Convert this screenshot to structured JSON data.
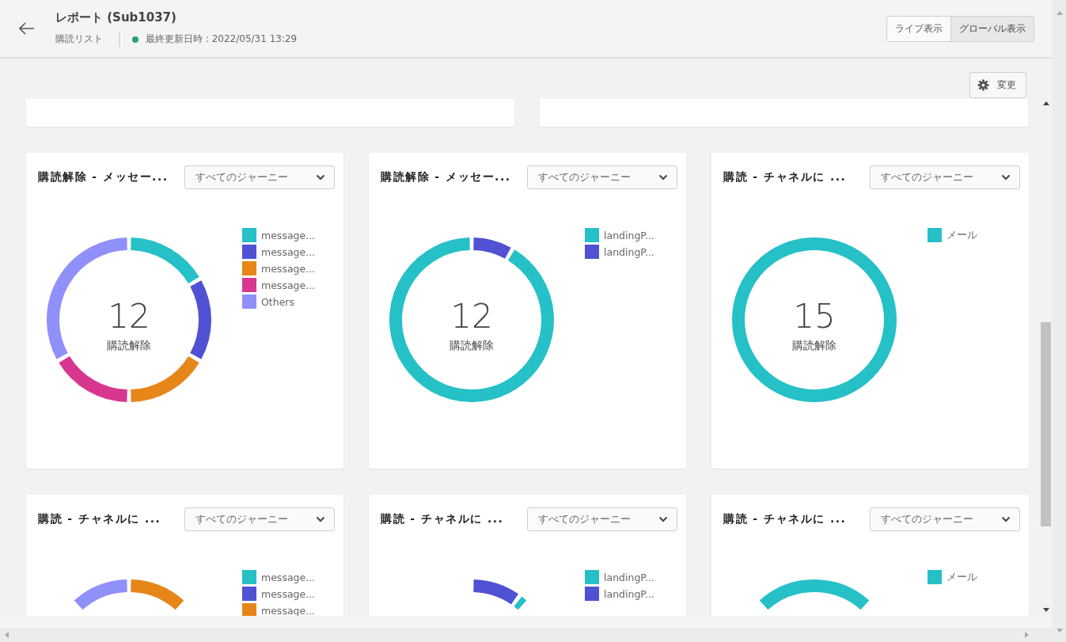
{
  "header": {
    "title": "レポート (Sub1037)",
    "subtitle": "購読リスト",
    "status": "最終更新日時 : 2022/05/31 13:29"
  },
  "view_toggle": [
    {
      "label": "ライブ表示",
      "selected": false
    },
    {
      "label": "グローバル表示",
      "selected": true
    }
  ],
  "change_button": "変更",
  "cards": [
    {
      "title": "購読解除 - メッセー...",
      "dropdown": "すべてのジャーニー",
      "total": "12",
      "total_label": "購読解除",
      "legend": [
        {
          "label": "message...",
          "color": "#26c0c7"
        },
        {
          "label": "message...",
          "color": "#5151d3"
        },
        {
          "label": "message...",
          "color": "#e68619"
        },
        {
          "label": "message...",
          "color": "#d83790"
        },
        {
          "label": "Others",
          "color": "#9090fa"
        }
      ]
    },
    {
      "title": "購読解除 - メッセー...",
      "dropdown": "すべてのジャーニー",
      "total": "12",
      "total_label": "購読解除",
      "legend": [
        {
          "label": "landingP...",
          "color": "#26c0c7"
        },
        {
          "label": "landingP...",
          "color": "#5151d3"
        }
      ]
    },
    {
      "title": "購読 - チャネルに ...",
      "dropdown": "すべてのジャーニー",
      "total": "15",
      "total_label": "購読解除",
      "legend": [
        {
          "label": "メール",
          "color": "#26c0c7"
        }
      ]
    },
    {
      "title": "購読 - チャネルに ...",
      "dropdown": "すべてのジャーニー",
      "legend": [
        {
          "label": "message...",
          "color": "#26c0c7"
        },
        {
          "label": "message...",
          "color": "#5151d3"
        },
        {
          "label": "message...",
          "color": "#e68619"
        }
      ]
    },
    {
      "title": "購読 - チャネルに ...",
      "dropdown": "すべてのジャーニー",
      "legend": [
        {
          "label": "landingP...",
          "color": "#26c0c7"
        },
        {
          "label": "landingP...",
          "color": "#5151d3"
        }
      ]
    },
    {
      "title": "購読 - チャネルに ...",
      "dropdown": "すべてのジャーニー",
      "legend": [
        {
          "label": "メール",
          "color": "#26c0c7"
        }
      ]
    }
  ]
}
